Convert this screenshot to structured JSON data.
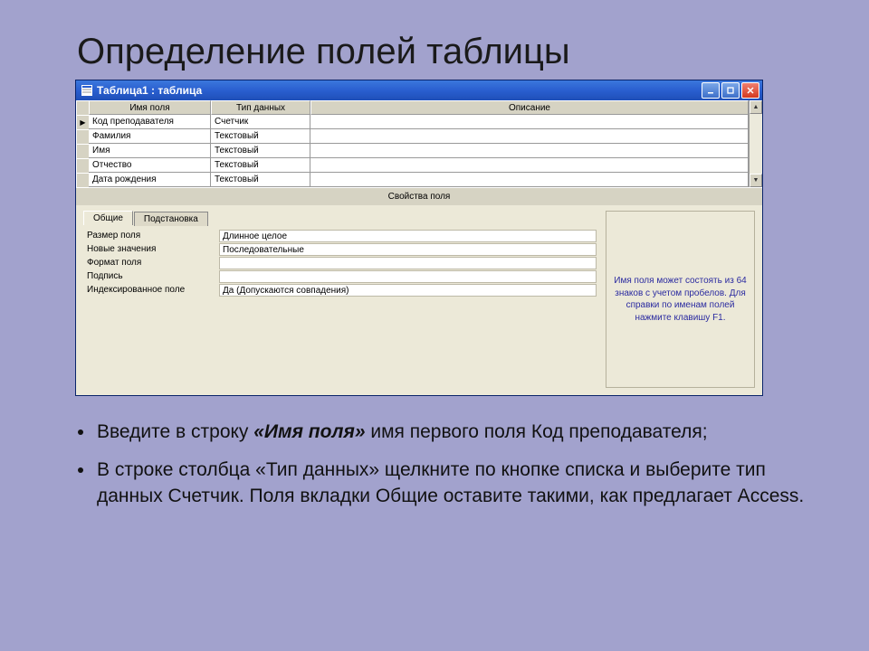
{
  "slide_title": "Определение полей таблицы",
  "window": {
    "title": "Таблица1 : таблица",
    "columns": {
      "name": "Имя поля",
      "type": "Тип данных",
      "desc": "Описание"
    },
    "rows": [
      {
        "marker": "▶",
        "name": "Код преподавателя",
        "type": "Счетчик",
        "desc": ""
      },
      {
        "marker": "",
        "name": "Фамилия",
        "type": "Текстовый",
        "desc": ""
      },
      {
        "marker": "",
        "name": "Имя",
        "type": "Текстовый",
        "desc": ""
      },
      {
        "marker": "",
        "name": "Отчество",
        "type": "Текстовый",
        "desc": ""
      },
      {
        "marker": "",
        "name": "Дата рождения",
        "type": "Текстовый",
        "desc": ""
      }
    ],
    "fp_title": "Свойства поля",
    "tabs": {
      "general": "Общие",
      "lookup": "Подстановка"
    },
    "props": [
      {
        "label": "Размер поля",
        "value": "Длинное целое"
      },
      {
        "label": "Новые значения",
        "value": "Последовательные"
      },
      {
        "label": "Формат поля",
        "value": ""
      },
      {
        "label": "Подпись",
        "value": ""
      },
      {
        "label": "Индексированное поле",
        "value": "Да (Допускаются совпадения)"
      }
    ],
    "help": "Имя поля может состоять из 64 знаков с учетом пробелов. Для справки по именам полей нажмите клавишу F1."
  },
  "bullets": {
    "b1_pre": "Введите в строку ",
    "b1_bi": "«Имя поля»",
    "b1_post": " имя первого поля Код преподавателя;",
    "b2": "В строке столбца «Тип данных» щелкните по кнопке списка и выберите тип данных Счетчик. Поля вкладки Общие оставите такими, как предлагает Access."
  }
}
